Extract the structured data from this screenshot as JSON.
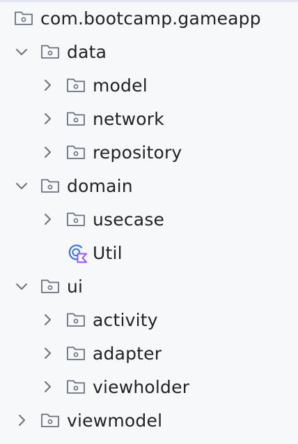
{
  "tree": {
    "root": {
      "label": "com.bootcamp.gameapp",
      "icon": "package-folder-icon"
    },
    "items": [
      {
        "label": "data",
        "expanded": true,
        "icon": "package-folder-icon"
      },
      {
        "label": "model",
        "expanded": false,
        "icon": "package-folder-icon"
      },
      {
        "label": "network",
        "expanded": false,
        "icon": "package-folder-icon"
      },
      {
        "label": "repository",
        "expanded": false,
        "icon": "package-folder-icon"
      },
      {
        "label": "domain",
        "expanded": true,
        "icon": "package-folder-icon"
      },
      {
        "label": "usecase",
        "expanded": false,
        "icon": "package-folder-icon"
      },
      {
        "label": "Util",
        "icon": "kotlin-class-icon"
      },
      {
        "label": "ui",
        "expanded": true,
        "icon": "package-folder-icon"
      },
      {
        "label": "activity",
        "expanded": false,
        "icon": "package-folder-icon"
      },
      {
        "label": "adapter",
        "expanded": false,
        "icon": "package-folder-icon"
      },
      {
        "label": "viewholder",
        "expanded": false,
        "icon": "package-folder-icon"
      },
      {
        "label": "viewmodel",
        "expanded": false,
        "icon": "package-folder-icon"
      }
    ]
  },
  "colors": {
    "background": "#f7f8fa",
    "text": "#222222",
    "icon_stroke": "#6c707e",
    "kotlin_blue": "#3574f0",
    "kotlin_purple": "#9b4dff"
  }
}
